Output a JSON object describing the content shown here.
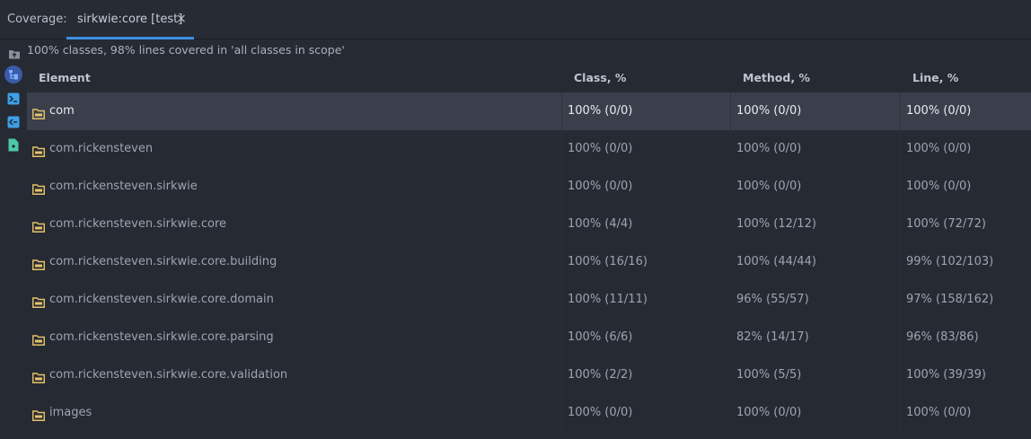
{
  "toolbar": {
    "coverage_label": "Coverage:",
    "tab_title": "sirkwie:core [test]",
    "tab_close": "×"
  },
  "summary": "100% classes, 98% lines covered in 'all classes in scope'",
  "columns": [
    "Element",
    "Class, %",
    "Method, %",
    "Line, %"
  ],
  "rows": [
    {
      "element": "com",
      "class_pct": "100% (0/0)",
      "method_pct": "100% (0/0)",
      "line_pct": "100% (0/0)",
      "selected": true
    },
    {
      "element": "com.rickensteven",
      "class_pct": "100% (0/0)",
      "method_pct": "100% (0/0)",
      "line_pct": "100% (0/0)"
    },
    {
      "element": "com.rickensteven.sirkwie",
      "class_pct": "100% (0/0)",
      "method_pct": "100% (0/0)",
      "line_pct": "100% (0/0)"
    },
    {
      "element": "com.rickensteven.sirkwie.core",
      "class_pct": "100% (4/4)",
      "method_pct": "100% (12/12)",
      "line_pct": "100% (72/72)"
    },
    {
      "element": "com.rickensteven.sirkwie.core.building",
      "class_pct": "100% (16/16)",
      "method_pct": "100% (44/44)",
      "line_pct": "99% (102/103)"
    },
    {
      "element": "com.rickensteven.sirkwie.core.domain",
      "class_pct": "100% (11/11)",
      "method_pct": "96% (55/57)",
      "line_pct": "97% (158/162)"
    },
    {
      "element": "com.rickensteven.sirkwie.core.parsing",
      "class_pct": "100% (6/6)",
      "method_pct": "82% (14/17)",
      "line_pct": "96% (83/86)"
    },
    {
      "element": "com.rickensteven.sirkwie.core.validation",
      "class_pct": "100% (2/2)",
      "method_pct": "100% (5/5)",
      "line_pct": "100% (39/39)"
    },
    {
      "element": "images",
      "class_pct": "100% (0/0)",
      "method_pct": "100% (0/0)",
      "line_pct": "100% (0/0)"
    }
  ],
  "left_toolbar_icons": [
    "flatten-packages-icon",
    "generate-report-icon",
    "import-report-icon",
    "export-icon"
  ],
  "colors": {
    "background": "#262a33",
    "selected_row": "#3a3f4b",
    "tab_underline": "#3d8fe0",
    "folder": "#e6c36a",
    "toolbar_icon": "#3fa0e6"
  }
}
